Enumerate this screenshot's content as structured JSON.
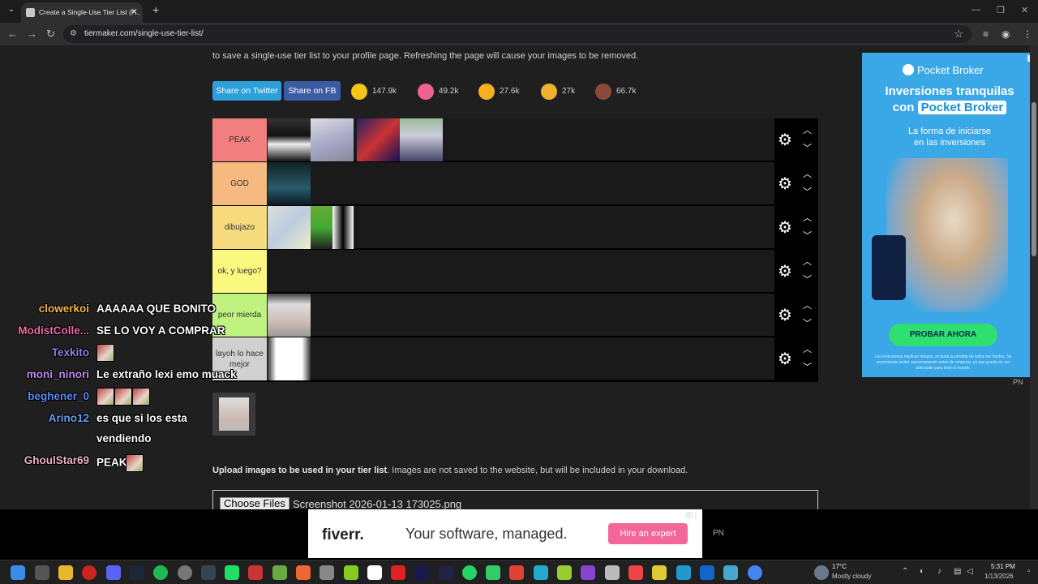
{
  "browser": {
    "tab_title": "Create a Single-Use Tier List (P...",
    "url": "tiermaker.com/single-use-tier-list/"
  },
  "page": {
    "intro_text": "to save a single-use tier list to your profile page. Refreshing the page will cause your images to be removed.",
    "share_twitter": "Share on Twitter",
    "share_fb": "Share on FB",
    "reactions": [
      {
        "icon": "grin-emoji-icon",
        "count": "147.9k",
        "color": "#f5c518"
      },
      {
        "icon": "heart-eyes-emoji-icon",
        "count": "49.2k",
        "color": "#f06090"
      },
      {
        "icon": "laughing-emoji-icon",
        "count": "27.6k",
        "color": "#f5b020"
      },
      {
        "icon": "praise-hands-emoji-icon",
        "count": "27k",
        "color": "#f0b030"
      },
      {
        "icon": "poop-emoji-icon",
        "count": "66.7k",
        "color": "#8a4a3a"
      }
    ],
    "tiers": [
      {
        "label": "PEAK",
        "color": "#f27f7f"
      },
      {
        "label": "GOD",
        "color": "#f6b97f"
      },
      {
        "label": "dibujazo",
        "color": "#f6dc7f"
      },
      {
        "label": "ok, y luego?",
        "color": "#fbf87f"
      },
      {
        "label": "peor mierda",
        "color": "#bff27f"
      },
      {
        "label": "layoh lo hace mejor",
        "color": "#d0d0d0"
      }
    ],
    "upload_bold": "Upload images to be used in your tier list",
    "upload_rest": ". Images are not saved to the website, but will be included in your download.",
    "choose_files": "Choose Files",
    "file_name": "Screenshot 2026-01-13 173025.png"
  },
  "side_ad": {
    "brand": "Pocket Broker",
    "headline_1": "Inversiones tranquilas",
    "headline_2_pre": "con",
    "headline_2_hl": "Pocket Broker",
    "sub_1": "La forma de iniciarse",
    "sub_2": "en las inversiones",
    "cta": "PROBAR AHORA",
    "fine": "Las inversiones implican riesgos, incluida la pérdida de todos los fondos. Se recomienda recibir asesoramiento antes de empezar, ya que puede no ser adecuado para todo el mundo.",
    "pn": "PN"
  },
  "chat": [
    {
      "user": "clowerkoi",
      "color": "#f5b94a",
      "msg": "AAAAAA QUE BONITO",
      "emotes": 0
    },
    {
      "user": "ModistColle...",
      "color": "#f06aa8",
      "msg": "SE LO VOY A COMPRAR",
      "emotes": 0
    },
    {
      "user": "Texkito",
      "color": "#9b7bf0",
      "msg": "",
      "emotes": 1
    },
    {
      "user": "moni_ninori",
      "color": "#c08af5",
      "msg": "Le extraño lexi emo muack",
      "emotes": 0
    },
    {
      "user": "beghener_0",
      "color": "#5a8cf0",
      "msg": "",
      "emotes": 3
    },
    {
      "user": "Arino12",
      "color": "#6aa0f0",
      "msg": "es que si los esta",
      "msg2": "vendiendo",
      "emotes": 0
    },
    {
      "user": "GhoulStar69",
      "color": "#f0b0c8",
      "msg": "PEAK",
      "emotes": 1
    }
  ],
  "bottom_ad": {
    "logo": "fiverr.",
    "text": "Your software, managed.",
    "button": "Hire an expert",
    "pn": "PN"
  },
  "taskbar": {
    "weather_temp": "17°C",
    "weather_desc": "Mostly cloudy",
    "time": "5:31 PM",
    "date": "1/13/2026"
  }
}
